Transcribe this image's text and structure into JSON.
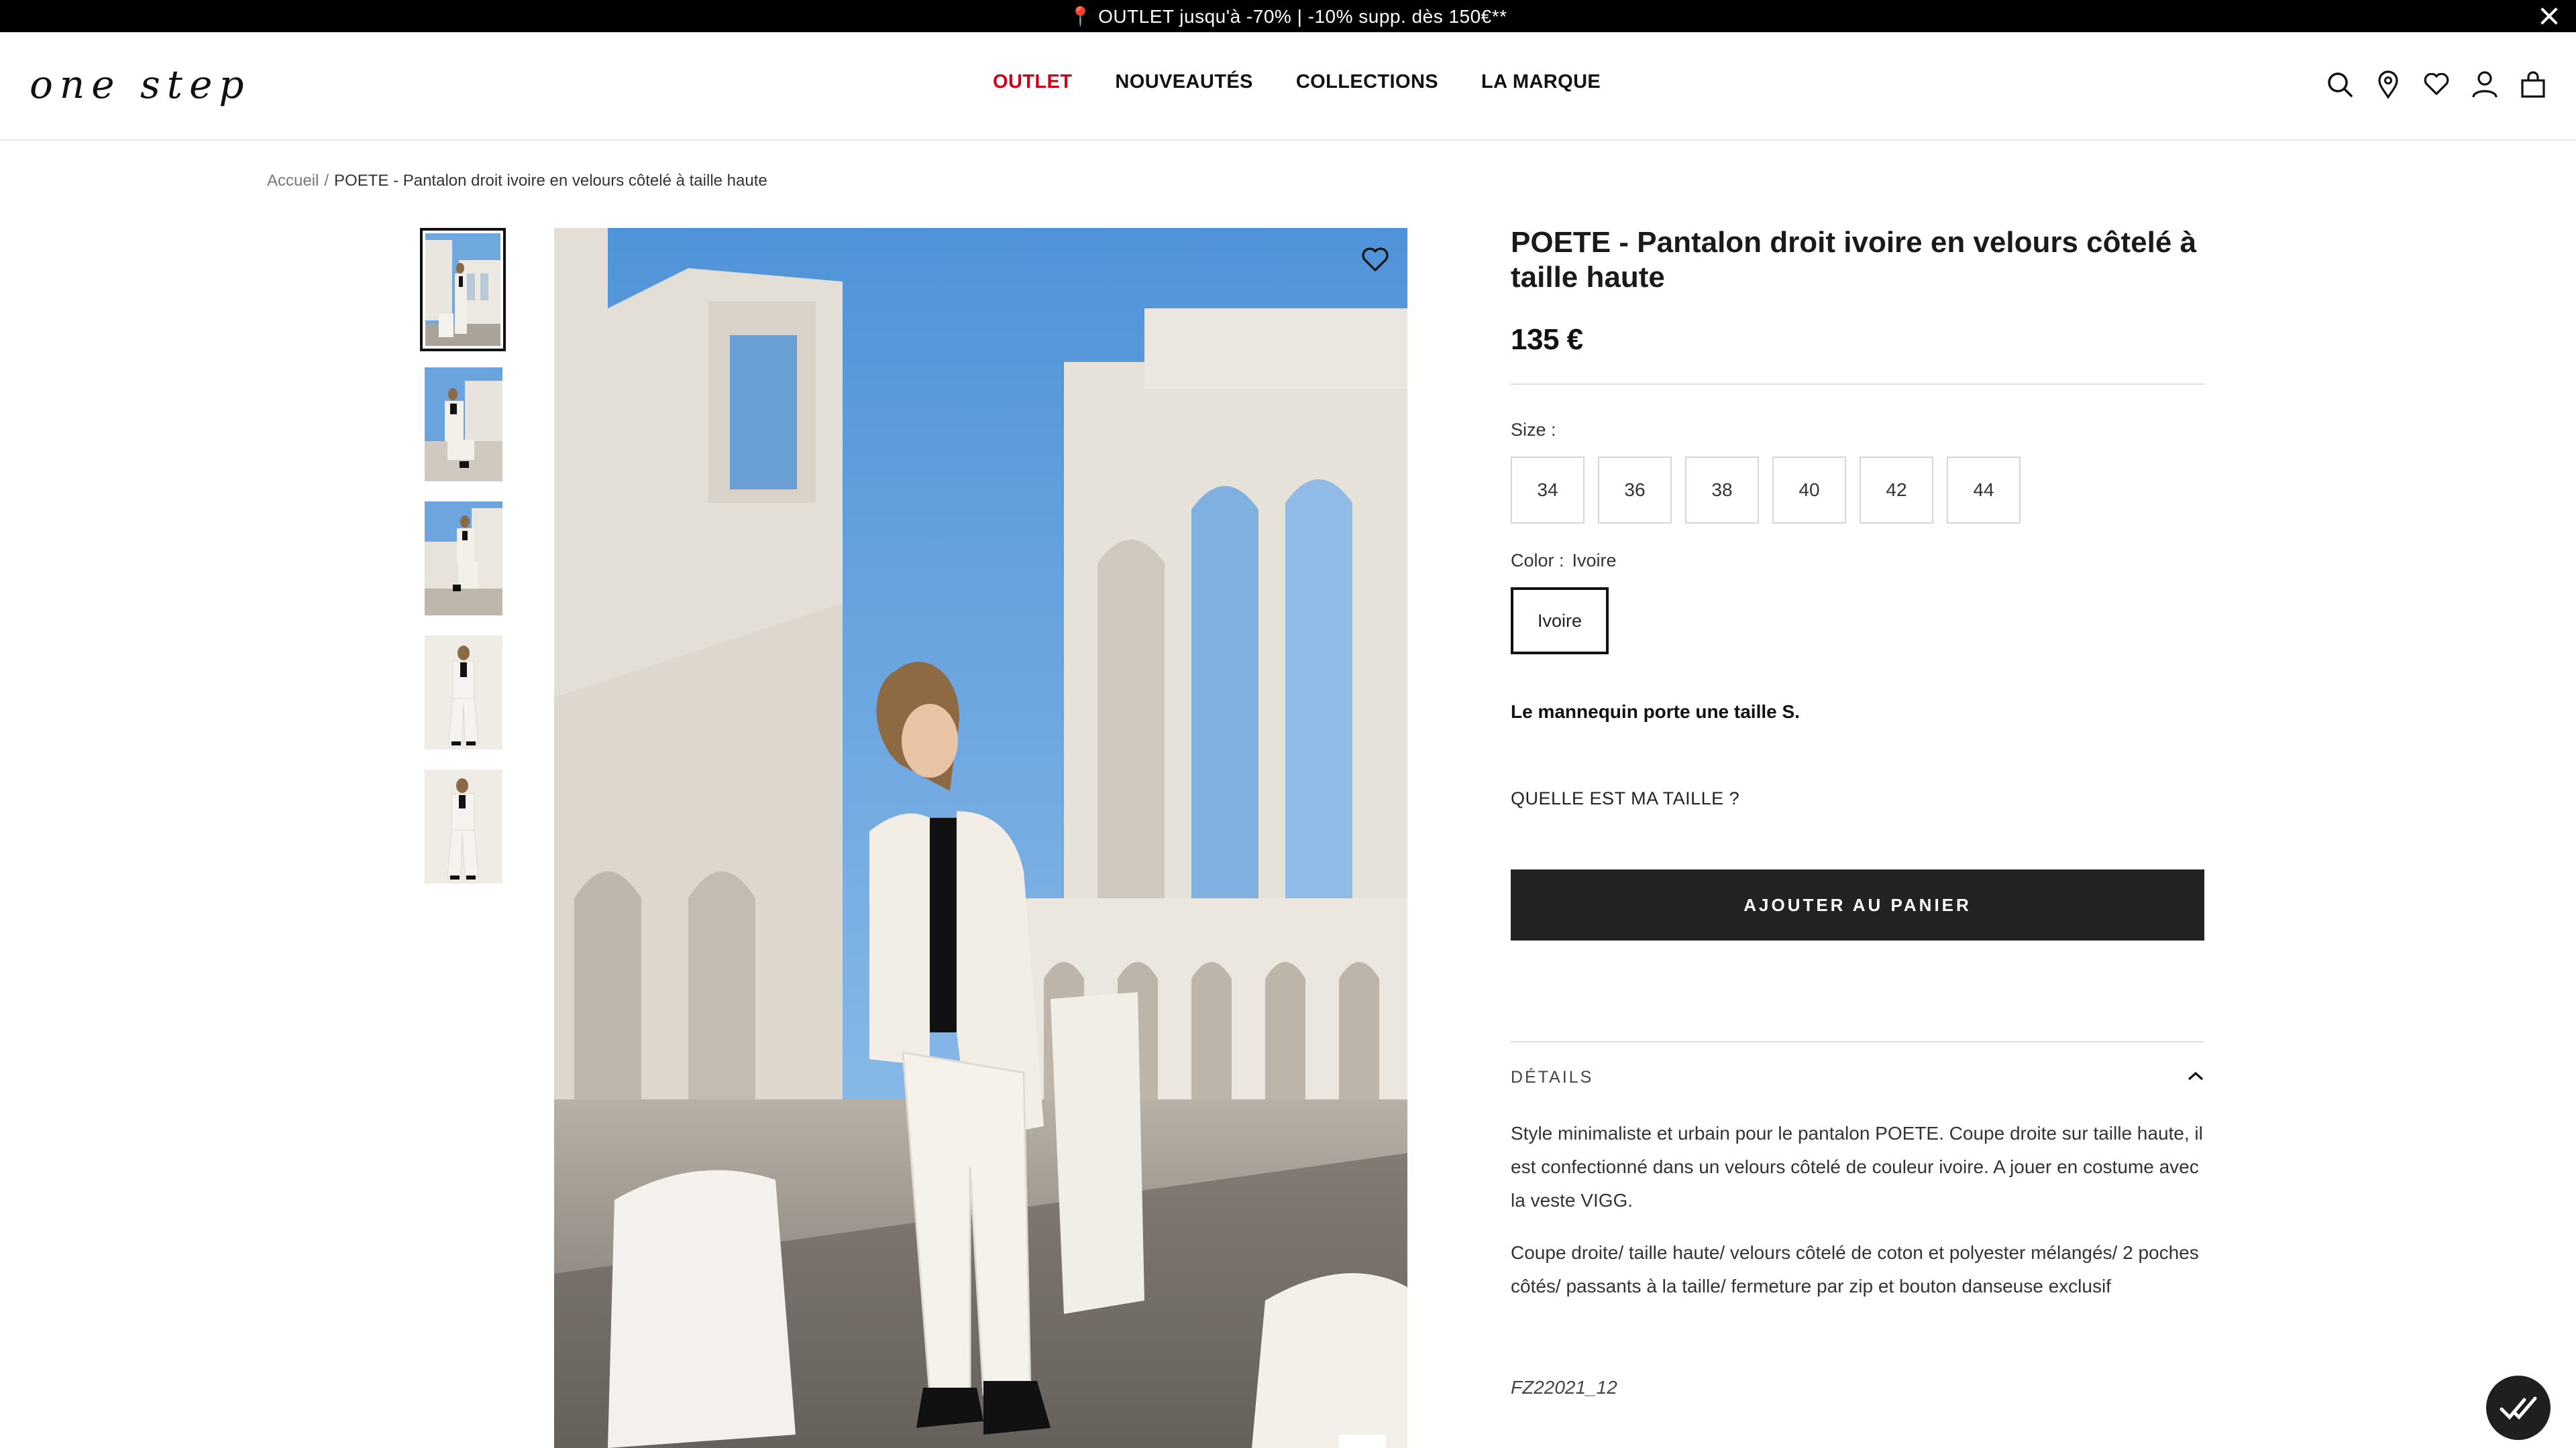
{
  "announcement": {
    "text": "📍 OUTLET jusqu'à -70% | -10% supp. dès 150€**"
  },
  "header": {
    "logo": "one step",
    "nav": [
      {
        "label": "OUTLET",
        "color": "#d0021b"
      },
      {
        "label": "NOUVEAUTÉS"
      },
      {
        "label": "COLLECTIONS"
      },
      {
        "label": "LA MARQUE"
      }
    ],
    "icons": [
      "search-icon",
      "store-locator-icon",
      "wishlist-icon",
      "account-icon",
      "cart-icon"
    ]
  },
  "breadcrumb": {
    "home": "Accueil",
    "separator": "/",
    "current": "POETE - Pantalon droit ivoire en velours côtelé à taille haute"
  },
  "gallery": {
    "thumbnail_count": 5,
    "active_index": 0
  },
  "product": {
    "title": "POETE - Pantalon droit ivoire en velours côtelé à taille haute",
    "price": "135 €",
    "size_label": "Size :",
    "sizes": [
      "34",
      "36",
      "38",
      "40",
      "42",
      "44"
    ],
    "color_label": "Color :",
    "color_value": "Ivoire",
    "swatch": "Ivoire",
    "model_note": "Le mannequin porte une taille S.",
    "size_guide": "QUELLE EST MA TAILLE ?",
    "add_to_cart": "AJOUTER AU PANIER",
    "details_title": "DÉTAILS",
    "description": [
      "Style minimaliste et urbain pour le pantalon POETE. Coupe droite sur taille haute, il est confectionné dans un velours côtelé de couleur ivoire. A jouer en costume avec la veste VIGG.",
      "Coupe droite/ taille haute/ velours côtelé de coton et polyester mélangés/ 2 poches côtés/ passants à la taille/ fermeture par zip et bouton danseuse exclusif"
    ],
    "reference": "FZ22021_12"
  },
  "colors": {
    "accent": "#d0021b",
    "button": "#222222",
    "sky": "#5b9bdc"
  }
}
